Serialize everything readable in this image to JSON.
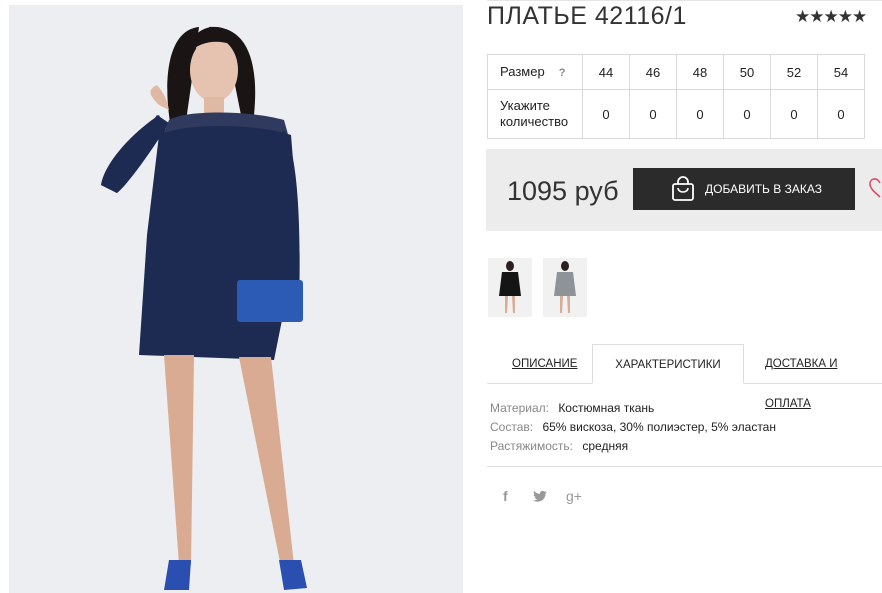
{
  "product": {
    "title": "ПЛАТЬЕ 42116/1",
    "stars": "★★★★★",
    "rating": 5
  },
  "sizes": {
    "size_label": "Размер",
    "help": "?",
    "qty_label_1": "Укажите",
    "qty_label_2": "количество",
    "list": [
      "44",
      "46",
      "48",
      "50",
      "52",
      "54"
    ],
    "quantities": [
      "0",
      "0",
      "0",
      "0",
      "0",
      "0"
    ]
  },
  "buy": {
    "price": "1095 руб",
    "add_label": "ДОБАВИТЬ В ЗАКАЗ",
    "icons": {
      "bag": "shopping-bag-icon",
      "wishlist": "heart-icon"
    }
  },
  "tabs": {
    "description": "ОПИСАНИЕ",
    "characteristics": "ХАРАКТЕРИСТИКИ",
    "delivery": "ДОСТАВКА И ОПЛАТА"
  },
  "specs": {
    "material_k": "Материал:",
    "material_v": "Костюмная ткань",
    "composition_k": "Состав:",
    "composition_v": "65% вискоза, 30% полиэстер, 5% эластан",
    "stretch_k": "Растяжимость:",
    "stretch_v": "средняя"
  },
  "social": {
    "facebook": "f",
    "twitter": "twitter-icon",
    "gplus": "g+"
  },
  "colors": {
    "dress": "#1d2a52",
    "button": "#2b2b2b",
    "heart": "#d94b6e"
  }
}
